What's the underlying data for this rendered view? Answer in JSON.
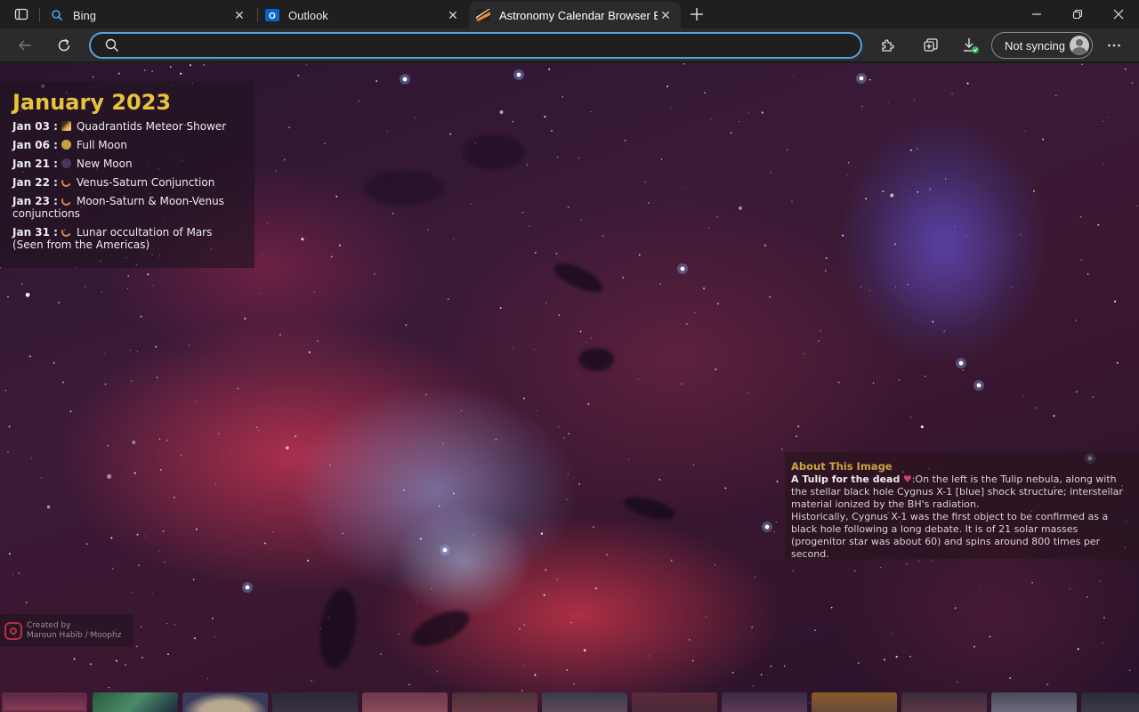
{
  "browser": {
    "tabs": [
      {
        "title": "Bing",
        "active": false
      },
      {
        "title": "Outlook",
        "active": false
      },
      {
        "title": "Astronomy Calendar Browser Ext",
        "active": true
      }
    ],
    "address": {
      "value": "",
      "placeholder": ""
    },
    "sync_label": "Not syncing"
  },
  "calendar": {
    "title": "January 2023",
    "events": [
      {
        "date": "Jan 03 :",
        "icon": "meteor-icon",
        "text": "Quadrantids Meteor Shower"
      },
      {
        "date": "Jan 06 :",
        "icon": "full-moon-icon",
        "text": "Full Moon"
      },
      {
        "date": "Jan 21 :",
        "icon": "new-moon-icon",
        "text": "New Moon"
      },
      {
        "date": "Jan 22 :",
        "icon": "conjunction-icon",
        "text": "Venus-Saturn Conjunction"
      },
      {
        "date": "Jan 23 :",
        "icon": "conjunction-icon",
        "text": "Moon-Saturn & Moon-Venus conjunctions"
      },
      {
        "date": "Jan 31 :",
        "icon": "occultation-icon",
        "text": "Lunar occultation of Mars (Seen from the Americas)"
      }
    ]
  },
  "about": {
    "title": "About This Image",
    "image_name": "A Tulip for the dead",
    "paragraph1": ":On the left is the Tulip nebula, along with the stellar black hole Cygnus X-1 [blue] shock structure; interstellar material ionized by the BH's radiation.",
    "paragraph2": "Historically, Cygnus X-1 was the first object to be confirmed as a black hole following a long debate. It is of 21 solar masses (progenitor star was about 60) and spins around 800 times per second."
  },
  "credit": {
    "line1": "Created by",
    "line2": "Maroun Habib / Moophz"
  },
  "colors": {
    "accent_gold": "#e8c43a",
    "address_focus": "#5aa0e0",
    "full_moon": "#c8a040",
    "new_moon": "#4a3458"
  }
}
